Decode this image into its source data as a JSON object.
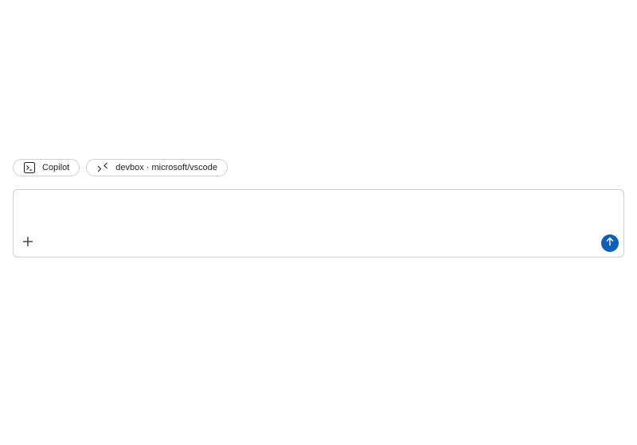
{
  "chips": {
    "agent": {
      "label": "Copilot",
      "icon": "terminal-icon"
    },
    "workspace": {
      "label": "devbox · microsoft/vscode",
      "icon": "remote-connection-icon"
    }
  },
  "composer": {
    "input_value": "",
    "add_icon": "plus-icon",
    "send_icon": "arrow-up-icon"
  },
  "colors": {
    "accent": "#0f5fb8",
    "border": "#cfcfcf",
    "text": "#1f1f1f"
  }
}
